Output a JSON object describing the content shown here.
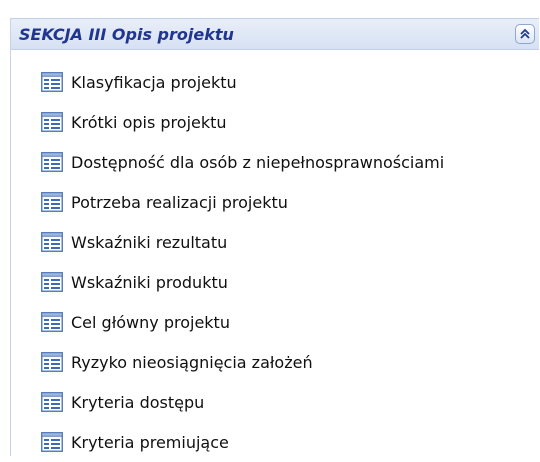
{
  "section": {
    "title": "SEKCJA III Opis projektu",
    "collapse_icon": "chevron-double-up-icon",
    "accent_color": "#20358f",
    "header_bg": "#dbe5f5"
  },
  "items": [
    {
      "label": "Klasyfikacja projektu",
      "icon": "list-icon"
    },
    {
      "label": "Krótki opis projektu",
      "icon": "list-icon"
    },
    {
      "label": "Dostępność dla osób z niepełnosprawnościami",
      "icon": "list-icon"
    },
    {
      "label": "Potrzeba realizacji projektu",
      "icon": "list-icon"
    },
    {
      "label": "Wskaźniki rezultatu",
      "icon": "list-icon"
    },
    {
      "label": "Wskaźniki produktu",
      "icon": "list-icon"
    },
    {
      "label": "Cel główny projektu",
      "icon": "list-icon"
    },
    {
      "label": "Ryzyko nieosiągnięcia założeń",
      "icon": "list-icon"
    },
    {
      "label": "Kryteria dostępu",
      "icon": "list-icon"
    },
    {
      "label": "Kryteria premiujące",
      "icon": "list-icon"
    }
  ]
}
